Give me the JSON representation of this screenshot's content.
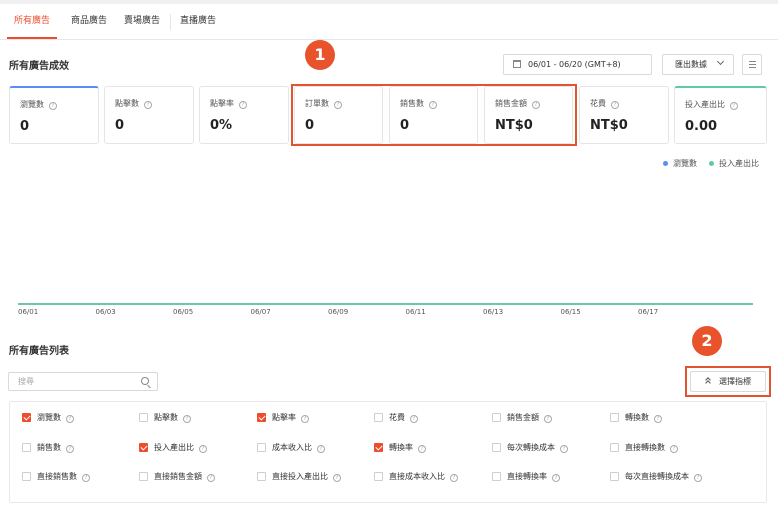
{
  "tabs": [
    {
      "label": "所有廣告",
      "active": true
    },
    {
      "label": "商品廣告",
      "active": false
    },
    {
      "label": "賣場廣告",
      "active": false
    },
    {
      "label": "直播廣告",
      "active": false
    }
  ],
  "performance": {
    "title": "所有廣告成效",
    "date_range": "06/01 - 06/20 (GMT+8)",
    "export_label": "匯出數據",
    "metrics": [
      {
        "label": "瀏覽數",
        "value": "0"
      },
      {
        "label": "點擊數",
        "value": "0"
      },
      {
        "label": "點擊率",
        "value": "0%"
      },
      {
        "label": "訂單數",
        "value": "0"
      },
      {
        "label": "銷售數",
        "value": "0"
      },
      {
        "label": "銷售金額",
        "value": "NT$0"
      },
      {
        "label": "花費",
        "value": "NT$0"
      },
      {
        "label": "投入產出比",
        "value": "0.00"
      }
    ],
    "legend": [
      {
        "label": "瀏覽數",
        "color": "#5a8dee"
      },
      {
        "label": "投入產出比",
        "color": "#5fc9a8"
      }
    ]
  },
  "badges": [
    "1",
    "2"
  ],
  "chart_data": {
    "type": "line",
    "x_ticks": [
      "06/01",
      "06/03",
      "06/05",
      "06/07",
      "06/09",
      "06/11",
      "06/13",
      "06/15",
      "06/17"
    ],
    "series": [
      {
        "name": "瀏覽數",
        "color": "#5a8dee",
        "values": [
          0,
          0,
          0,
          0,
          0,
          0,
          0,
          0,
          0
        ]
      },
      {
        "name": "投入產出比",
        "color": "#5fc9a8",
        "values": [
          0,
          0,
          0,
          0,
          0,
          0,
          0,
          0,
          0
        ]
      }
    ]
  },
  "list": {
    "title": "所有廣告列表",
    "search_placeholder": "搜尋",
    "select_metrics_label": "選擇指標",
    "metric_options": [
      {
        "label": "瀏覽數",
        "checked": true
      },
      {
        "label": "點擊數",
        "checked": false
      },
      {
        "label": "點擊率",
        "checked": true
      },
      {
        "label": "花費",
        "checked": false
      },
      {
        "label": "銷售金額",
        "checked": false
      },
      {
        "label": "轉換數",
        "checked": false
      },
      {
        "label": "銷售數",
        "checked": false
      },
      {
        "label": "投入產出比",
        "checked": true
      },
      {
        "label": "成本收入比",
        "checked": false
      },
      {
        "label": "轉換率",
        "checked": true
      },
      {
        "label": "每次轉換成本",
        "checked": false
      },
      {
        "label": "直接轉換數",
        "checked": false
      },
      {
        "label": "直接銷售數",
        "checked": false
      },
      {
        "label": "直接銷售金額",
        "checked": false
      },
      {
        "label": "直接投入產出比",
        "checked": false
      },
      {
        "label": "直接成本收入比",
        "checked": false
      },
      {
        "label": "直接轉換率",
        "checked": false
      },
      {
        "label": "每次直接轉換成本",
        "checked": false
      }
    ]
  }
}
